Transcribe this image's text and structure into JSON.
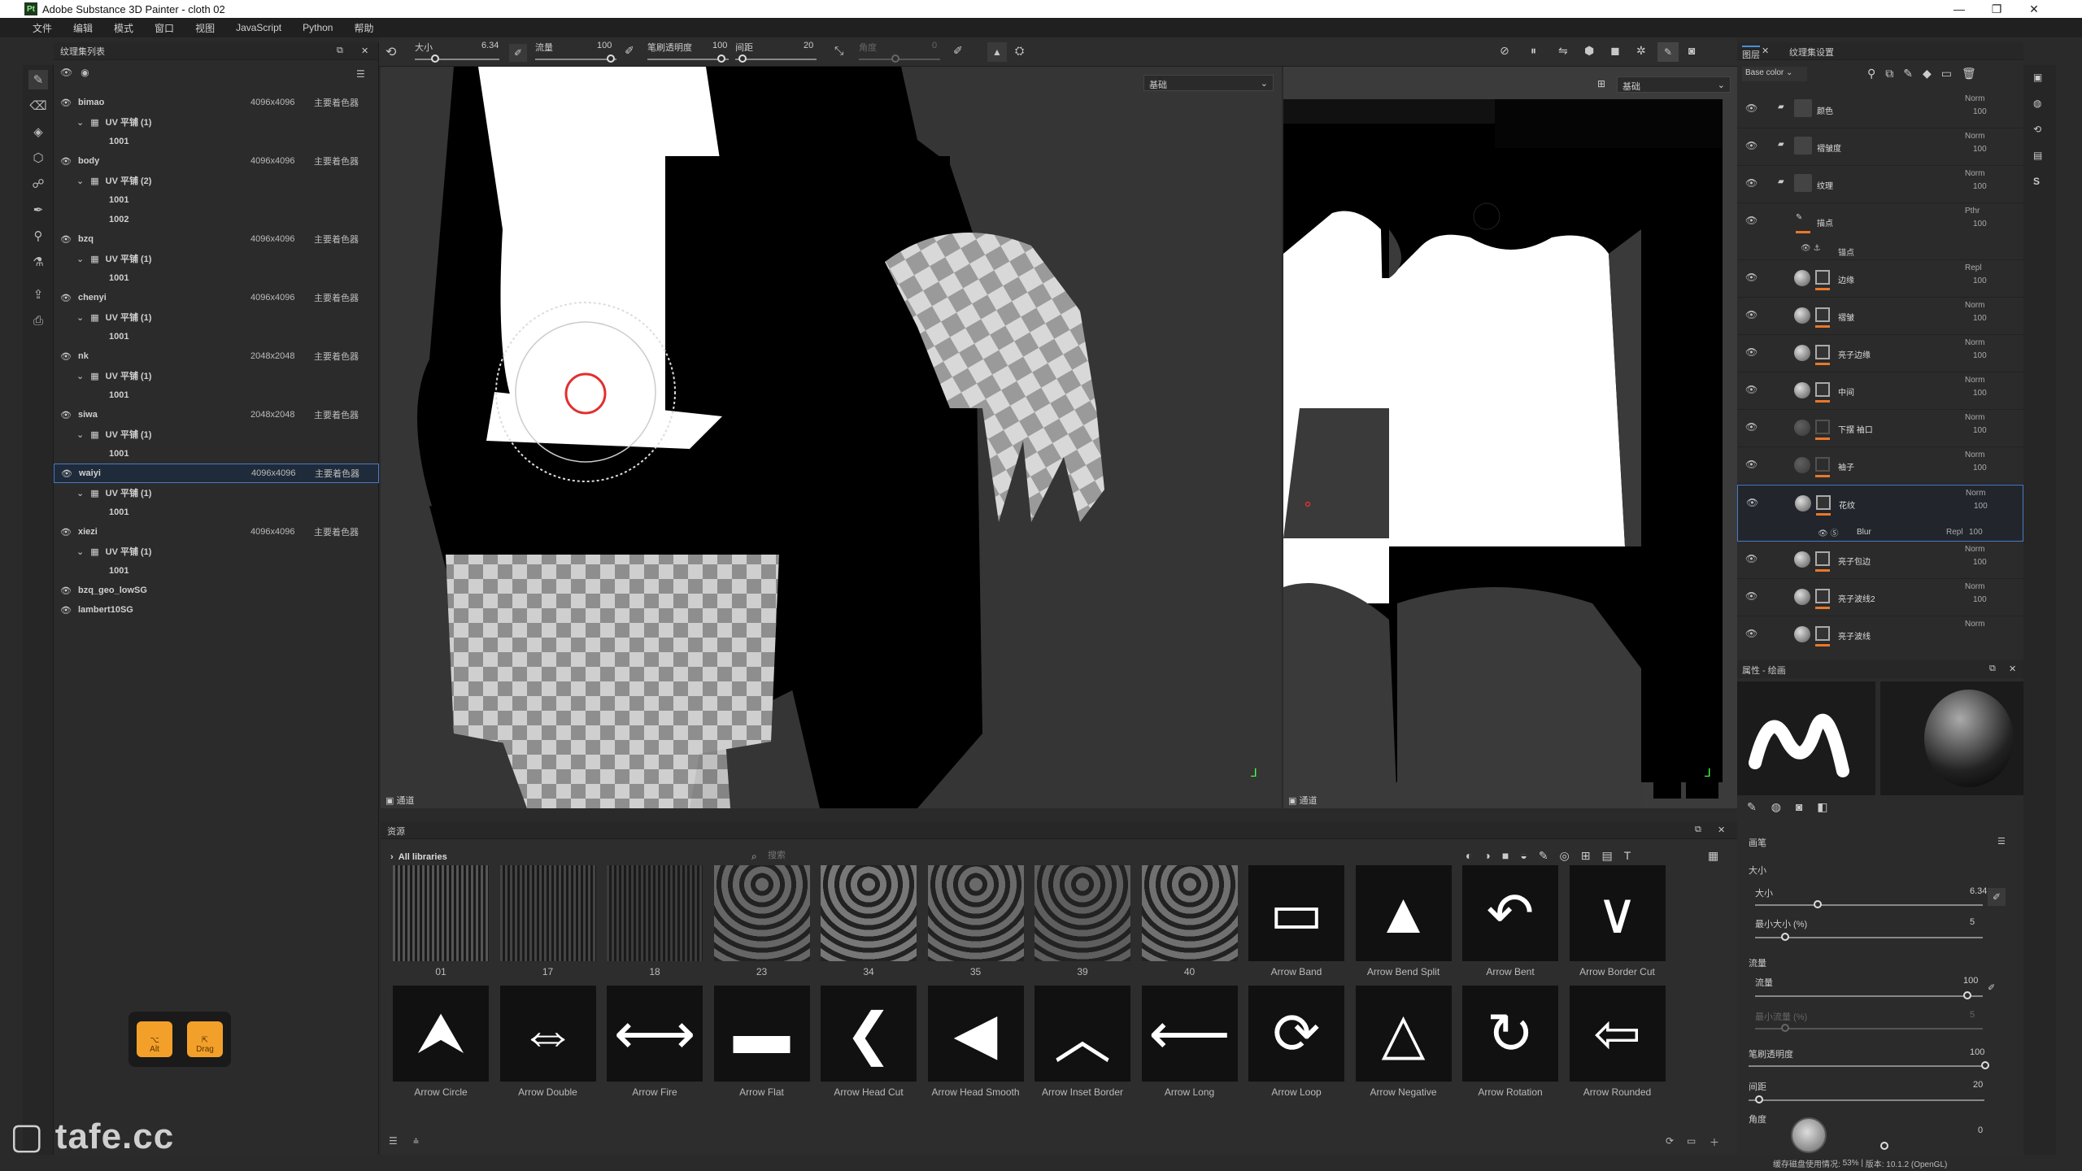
{
  "window": {
    "title": "Adobe Substance 3D Painter - cloth 02",
    "logo": "Pt"
  },
  "menu": [
    "文件",
    "编辑",
    "模式",
    "窗口",
    "视图",
    "JavaScript",
    "Python",
    "帮助"
  ],
  "texlist": {
    "title": "纹理集列表",
    "rows": [
      {
        "name": "bimao",
        "res": "4096x4096",
        "shader": "主要着色器"
      },
      {
        "uv": "UV 平铺 (1)"
      },
      {
        "tile": "1001"
      },
      {
        "name": "body",
        "res": "4096x4096",
        "shader": "主要着色器"
      },
      {
        "uv": "UV 平铺 (2)"
      },
      {
        "tile": "1001"
      },
      {
        "tile": "1002"
      },
      {
        "name": "bzq",
        "res": "4096x4096",
        "shader": "主要着色器"
      },
      {
        "uv": "UV 平铺 (1)"
      },
      {
        "tile": "1001"
      },
      {
        "name": "chenyi",
        "res": "4096x4096",
        "shader": "主要着色器"
      },
      {
        "uv": "UV 平铺 (1)"
      },
      {
        "tile": "1001"
      },
      {
        "name": "nk",
        "res": "2048x2048",
        "shader": "主要着色器"
      },
      {
        "uv": "UV 平铺 (1)"
      },
      {
        "tile": "1001"
      },
      {
        "name": "siwa",
        "res": "2048x2048",
        "shader": "主要着色器"
      },
      {
        "uv": "UV 平铺 (1)"
      },
      {
        "tile": "1001"
      },
      {
        "name": "waiyi",
        "res": "4096x4096",
        "shader": "主要着色器",
        "selected": true
      },
      {
        "uv": "UV 平铺 (1)"
      },
      {
        "tile": "1001"
      },
      {
        "name": "xiezi",
        "res": "4096x4096",
        "shader": "主要着色器"
      },
      {
        "uv": "UV 平铺 (1)"
      },
      {
        "tile": "1001"
      },
      {
        "name": "bzq_geo_lowSG",
        "dim": true
      },
      {
        "name": "lambert10SG",
        "dim": true
      }
    ]
  },
  "toolbar": {
    "size_label": "大小",
    "size_val": "6.34",
    "flow_label": "流量",
    "flow_val": "100",
    "stroke_label": "笔刷透明度",
    "stroke_val": "100",
    "spacing_label": "间距",
    "spacing_val": "20",
    "angle_label": "角度",
    "angle_val": "0"
  },
  "viewport": {
    "mode3d": "基础",
    "mode2d": "基础",
    "footer3d": "通道",
    "footer2d": "通道"
  },
  "assets": {
    "title": "资源",
    "library": "All libraries",
    "search_placeholder": "搜索",
    "row1": [
      "01",
      "17",
      "18",
      "23",
      "34",
      "35",
      "39",
      "40",
      "Arrow Band",
      "Arrow Bend Split",
      "Arrow Bent",
      "Arrow Border Cut"
    ],
    "row2": [
      "Arrow Circle",
      "Arrow Double",
      "Arrow Fire",
      "Arrow Flat",
      "Arrow Head Cut",
      "Arrow Head Smooth",
      "Arrow Inset Border",
      "Arrow Long",
      "Arrow Loop",
      "Arrow Negative",
      "Arrow Rotation",
      "Arrow Rounded"
    ]
  },
  "layers": {
    "tab1": "图层",
    "tab2": "纹理集设置",
    "channel": "Base color",
    "rows": [
      {
        "name": "颜色",
        "blend": "Norm",
        "op": "100",
        "type": "folder"
      },
      {
        "name": "褶皱度",
        "blend": "Norm",
        "op": "100",
        "type": "folder"
      },
      {
        "name": "纹理",
        "blend": "Norm",
        "op": "100",
        "type": "folder"
      },
      {
        "name": "描点",
        "blend": "Pthr",
        "op": "100",
        "type": "paint",
        "sub": "锚点"
      },
      {
        "name": "边缘",
        "blend": "Repl",
        "op": "100",
        "type": "fill"
      },
      {
        "name": "褶皱",
        "blend": "Norm",
        "op": "100",
        "type": "fill"
      },
      {
        "name": "亮子边缘",
        "blend": "Norm",
        "op": "100",
        "type": "fill"
      },
      {
        "name": "中间",
        "blend": "Norm",
        "op": "100",
        "type": "fill"
      },
      {
        "name": "下摆 袖口",
        "blend": "Norm",
        "op": "100",
        "type": "ghost"
      },
      {
        "name": "袖子",
        "blend": "Norm",
        "op": "100",
        "type": "ghost"
      },
      {
        "name": "花纹",
        "blend": "Norm",
        "op": "100",
        "type": "fill",
        "sel": true,
        "effect": "Blur",
        "eblend": "Repl",
        "eop": "100"
      },
      {
        "name": "亮子包边",
        "blend": "Norm",
        "op": "100",
        "type": "fill"
      },
      {
        "name": "亮子波线2",
        "blend": "Norm",
        "op": "100",
        "type": "fill"
      },
      {
        "name": "亮子波线",
        "blend": "Norm",
        "op": "",
        "type": "fill"
      }
    ]
  },
  "props": {
    "title": "属性 - 绘画",
    "section": "画笔",
    "size_group": "大小",
    "size": "大小",
    "size_val": "6.34",
    "minsize": "最小大小 (%)",
    "minsize_val": "5",
    "flow_group": "流量",
    "flow": "流量",
    "flow_val": "100",
    "minflow": "最小流量 (%)",
    "minflow_val": "5",
    "stroke": "笔刷透明度",
    "stroke_val": "100",
    "spacing": "间距",
    "spacing_val": "20",
    "angle": "角度",
    "angle_val": "0"
  },
  "keys": {
    "alt": "Alt",
    "drag": "Drag"
  },
  "watermark": "tafe.cc",
  "status": {
    "cache": "缓存磁盘使用情况:",
    "pct": "53%",
    "ver": "版本: 10.1.2 (OpenGL)"
  }
}
